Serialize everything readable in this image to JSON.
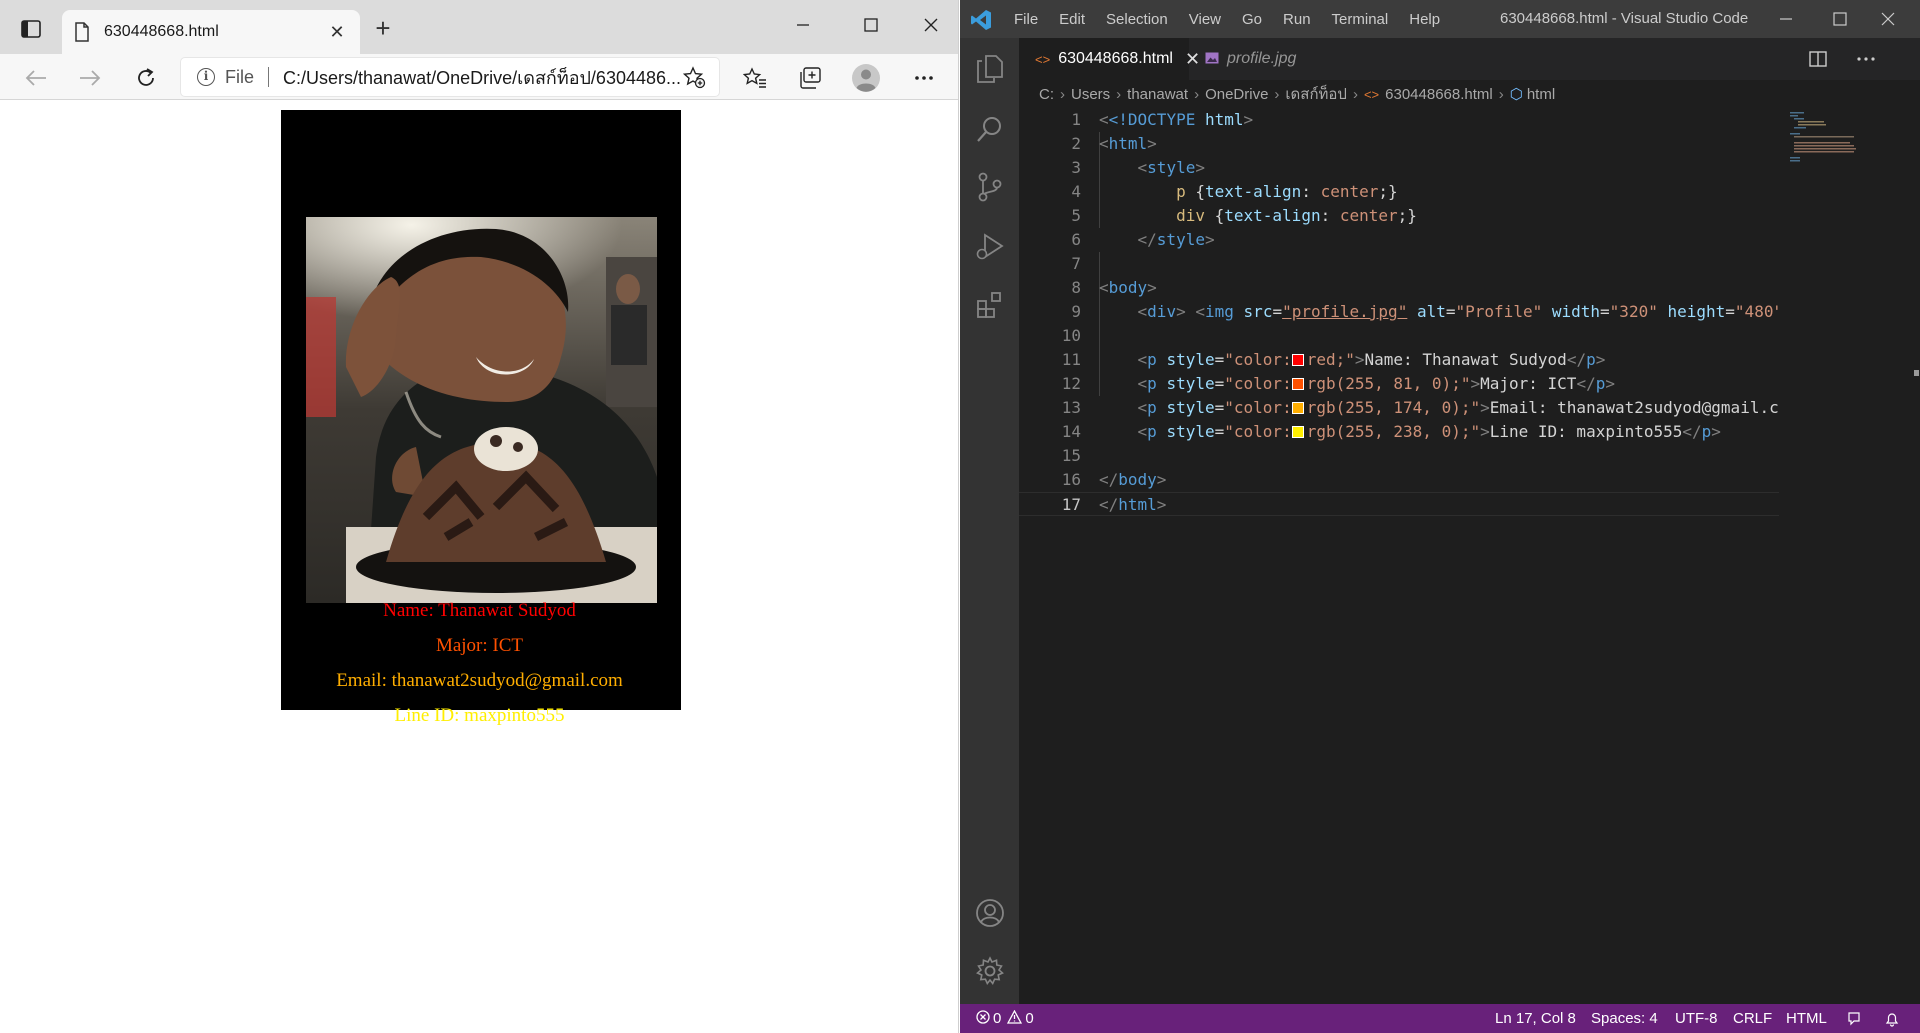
{
  "browser": {
    "tab_title": "630448668.html",
    "new_tab_label": "+",
    "address_scheme": "File",
    "address_url": "C:/Users/thanawat/OneDrive/เดสก์ท็อป/6304486...",
    "page": {
      "image_alt": "Profile",
      "lines": [
        {
          "text": "Name: Thanawat Sudyod",
          "color": "#ff0000"
        },
        {
          "text": "Major: ICT",
          "color": "#ff5100"
        },
        {
          "text": "Email: thanawat2sudyod@gmail.com",
          "color": "#ffae00"
        },
        {
          "text": "Line ID: maxpinto555",
          "color": "#ffee00"
        }
      ]
    },
    "icons": [
      "tab-actions-icon",
      "page-icon",
      "close-icon",
      "minimize-icon",
      "maximize-icon",
      "back-icon",
      "forward-icon",
      "refresh-icon",
      "info-icon",
      "add-favorite-icon",
      "favorites-icon",
      "collections-icon",
      "profile-icon",
      "more-icon"
    ]
  },
  "vscode": {
    "window_title": "630448668.html - Visual Studio Code",
    "menu": [
      "File",
      "Edit",
      "Selection",
      "View",
      "Go",
      "Run",
      "Terminal",
      "Help"
    ],
    "tabs": [
      {
        "label": "630448668.html",
        "icon": "<>",
        "active": true
      },
      {
        "label": "profile.jpg",
        "icon": "img",
        "active": false
      }
    ],
    "breadcrumb": [
      "C:",
      "Users",
      "thanawat",
      "OneDrive",
      "เดสก์ท็อป",
      "630448668.html",
      "html"
    ],
    "line_numbers": [
      "1",
      "2",
      "3",
      "4",
      "5",
      "6",
      "7",
      "8",
      "9",
      "10",
      "11",
      "12",
      "13",
      "14",
      "15",
      "16",
      "17"
    ],
    "code": {
      "l1_a": "<!DOCTYPE",
      "l1_b": "html",
      "l1_c": ">",
      "l2": "html",
      "l3": "style",
      "l4_sel": "p",
      "l4_prop": "text-align",
      "l4_val": "center",
      "l5_sel": "div",
      "l5_prop": "text-align",
      "l5_val": "center",
      "l6": "style",
      "l8": "body",
      "l9_div": "div",
      "l9_img": "img",
      "l9_src_attr": "src",
      "l9_src_val": "\"profile.jpg\"",
      "l9_alt_attr": "alt",
      "l9_alt_val": "\"Profile\"",
      "l9_w_attr": "width",
      "l9_w_val": "\"320\"",
      "l9_h_attr": "height",
      "l9_h_val": "\"480\"",
      "l11_val": "red;\"",
      "l11_text": "Name: Thanawat Sudyod",
      "l12_val": "rgb(255, 81, 0);\"",
      "l12_text": "Major: ICT",
      "l13_val": "rgb(255, 174, 0);\"",
      "l13_text": "Email: thanawat2sudyod@gmail.com",
      "l14_val": "rgb(255, 238, 0);\"",
      "l14_text": "Line ID: maxpinto555",
      "l16": "body",
      "l17": "html",
      "p_tag": "p",
      "style_attr": "style",
      "color_prefix": "\"color:"
    },
    "status": {
      "errors": "0",
      "warnings": "0",
      "position": "Ln 17, Col 8",
      "spaces": "Spaces: 4",
      "encoding": "UTF-8",
      "eol": "CRLF",
      "language": "HTML"
    },
    "colors": {
      "status_bar": "#68217a",
      "editor_bg": "#1e1e1e",
      "activity_bar": "#333333",
      "swatch_red": "#ff0000",
      "swatch_orange": "#ff5100",
      "swatch_amber": "#ffae00",
      "swatch_yellow": "#ffee00"
    },
    "icons": [
      "vscode-logo-icon",
      "explorer-icon",
      "search-icon",
      "source-control-icon",
      "run-debug-icon",
      "extensions-icon",
      "accounts-icon",
      "settings-gear-icon",
      "split-editor-icon",
      "more-actions-icon",
      "error-icon",
      "warning-icon",
      "feedback-icon",
      "notifications-icon"
    ]
  }
}
